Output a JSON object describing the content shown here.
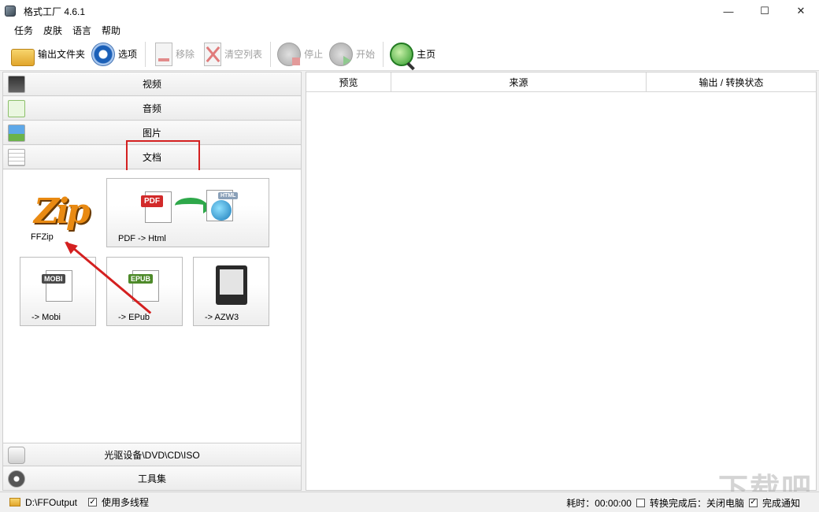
{
  "window": {
    "title": "格式工厂 4.6.1",
    "min": "—",
    "max": "☐",
    "close": "✕"
  },
  "menu": [
    "任务",
    "皮肤",
    "语言",
    "帮助"
  ],
  "toolbar": {
    "output_folder": "输出文件夹",
    "options": "选项",
    "remove": "移除",
    "clear_list": "清空列表",
    "stop": "停止",
    "start": "开始",
    "home": "主页"
  },
  "categories": {
    "video": "视频",
    "audio": "音频",
    "image": "图片",
    "document": "文档",
    "disc": "光驱设备\\DVD\\CD\\ISO",
    "tools": "工具集"
  },
  "tiles": {
    "ffzip": {
      "label": "FFZip",
      "logo": "Zip"
    },
    "pdf_html": {
      "label": "PDF -> Html",
      "badge_pdf": "PDF",
      "badge_html": "HTML"
    },
    "mobi": {
      "label": "-> Mobi",
      "badge": "MOBI"
    },
    "epub": {
      "label": "-> EPub",
      "badge": "EPUB"
    },
    "azw3": {
      "label": "-> AZW3"
    }
  },
  "table": {
    "columns": [
      "预览",
      "来源",
      "输出 / 转换状态"
    ]
  },
  "status": {
    "output_path": "D:\\FFOutput",
    "multithread": "使用多线程",
    "elapsed": "耗时：00:00:00",
    "after_convert": "转换完成后：关闭电脑",
    "notify": "完成通知",
    "check_mark": "✓"
  },
  "watermark": "下载吧"
}
